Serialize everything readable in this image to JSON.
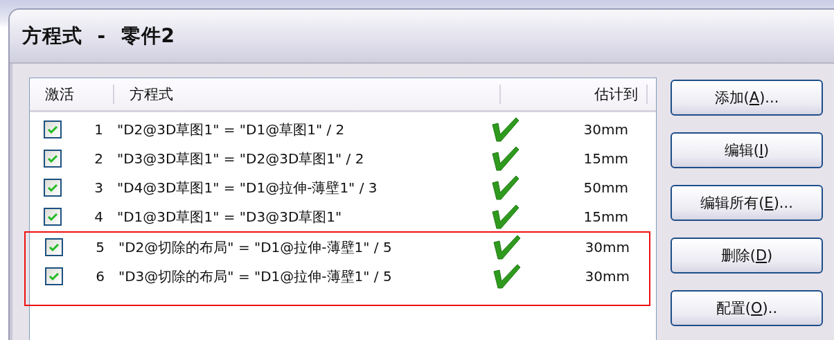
{
  "window": {
    "title": "方程式 - 零件2"
  },
  "table": {
    "columns": [
      "激活",
      "方程式",
      "估计到"
    ],
    "rows": [
      {
        "active": true,
        "number": "1",
        "equation": "\"D2@3D草图1\" = \"D1@草图1\" / 2",
        "valid": true,
        "value": "30mm",
        "highlighted": false
      },
      {
        "active": true,
        "number": "2",
        "equation": "\"D3@3D草图1\" = \"D2@3D草图1\" / 2",
        "valid": true,
        "value": "15mm",
        "highlighted": false
      },
      {
        "active": true,
        "number": "3",
        "equation": "\"D4@3D草图1\" = \"D1@拉伸-薄壁1\" / 3",
        "valid": true,
        "value": "50mm",
        "highlighted": false
      },
      {
        "active": true,
        "number": "4",
        "equation": "\"D1@3D草图1\" = \"D3@3D草图1\"",
        "valid": true,
        "value": "15mm",
        "highlighted": false
      },
      {
        "active": true,
        "number": "5",
        "equation": "\"D2@切除的布局\" = \"D1@拉伸-薄壁1\" / 5",
        "valid": true,
        "value": "30mm",
        "highlighted": true
      },
      {
        "active": true,
        "number": "6",
        "equation": "\"D3@切除的布局\" = \"D1@拉伸-薄壁1\" / 5",
        "valid": true,
        "value": "30mm",
        "highlighted": true
      }
    ]
  },
  "buttons": [
    {
      "before": "添加(",
      "key": "A",
      "after": ")..."
    },
    {
      "before": "编辑(",
      "key": "I",
      "after": ")"
    },
    {
      "before": "编辑所有(",
      "key": "E",
      "after": ")..."
    },
    {
      "before": "删除(",
      "key": "D",
      "after": ")"
    },
    {
      "before": "配置(",
      "key": "O",
      "after": ").."
    }
  ]
}
